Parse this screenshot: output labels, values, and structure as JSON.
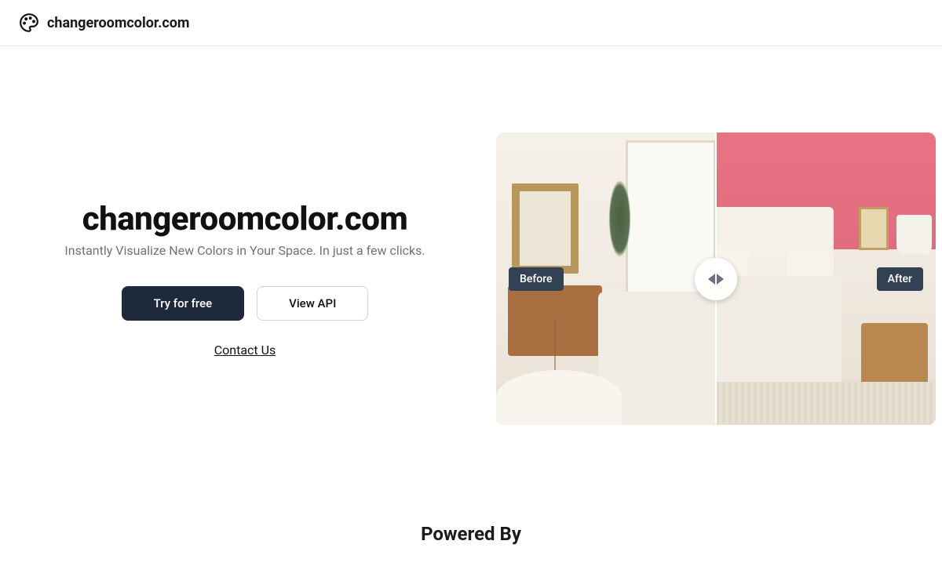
{
  "header": {
    "brand": "changeroomcolor.com"
  },
  "hero": {
    "title": "changeroomcolor.com",
    "subtitle": "Instantly Visualize New Colors in Your Space. In just a few clicks.",
    "cta_primary": "Try for free",
    "cta_secondary": "View API",
    "contact": "Contact Us"
  },
  "compare": {
    "before_label": "Before",
    "after_label": "After"
  },
  "footer": {
    "powered_by": "Powered By"
  }
}
